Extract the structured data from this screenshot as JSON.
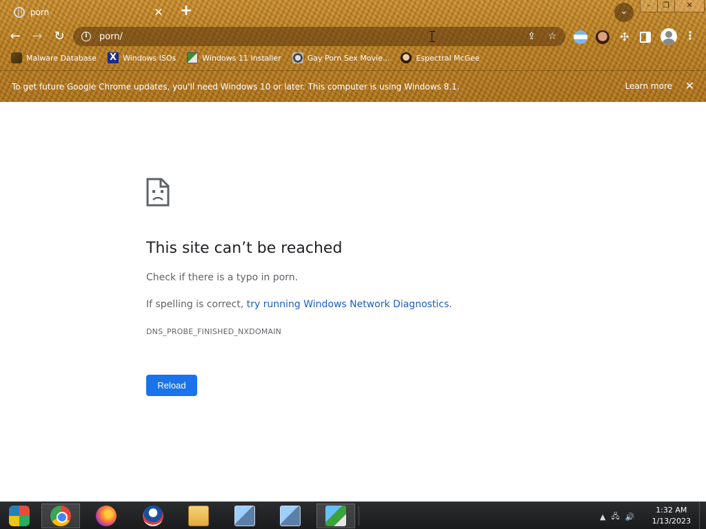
{
  "tab": {
    "title": "porn",
    "close_glyph": "✕"
  },
  "toolbar": {
    "url": "porn/",
    "back_glyph": "←",
    "forward_glyph": "→",
    "reload_glyph": "↻"
  },
  "bookmarks": [
    {
      "label": "Malware Database",
      "icon": "malware-database-icon"
    },
    {
      "label": "Windows ISOs",
      "icon": "x-icon"
    },
    {
      "label": "Windows 11 Installer",
      "icon": "windows-installer-icon"
    },
    {
      "label": "Gay Porn Sex Movie...",
      "icon": "film-reel-icon"
    },
    {
      "label": "Espectral McGee",
      "icon": "avatar-icon"
    }
  ],
  "infobar": {
    "message": "To get future Google Chrome updates, you'll need Windows 10 or later. This computer is using Windows 8.1.",
    "learn_more": "Learn more"
  },
  "error": {
    "title": "This site can’t be reached",
    "line1": "Check if there is a typo in porn.",
    "line2_prefix": "If spelling is correct, ",
    "line2_link": "try running Windows Network Diagnostics",
    "line2_suffix": ".",
    "code": "DNS_PROBE_FINISHED_NXDOMAIN",
    "reload_label": "Reload"
  },
  "taskbar": {
    "time": "1:32 AM",
    "date": "1/13/2023"
  },
  "colors": {
    "accent": "#1a73e8",
    "link": "#1a5ec4",
    "theme": "#b57a22"
  }
}
